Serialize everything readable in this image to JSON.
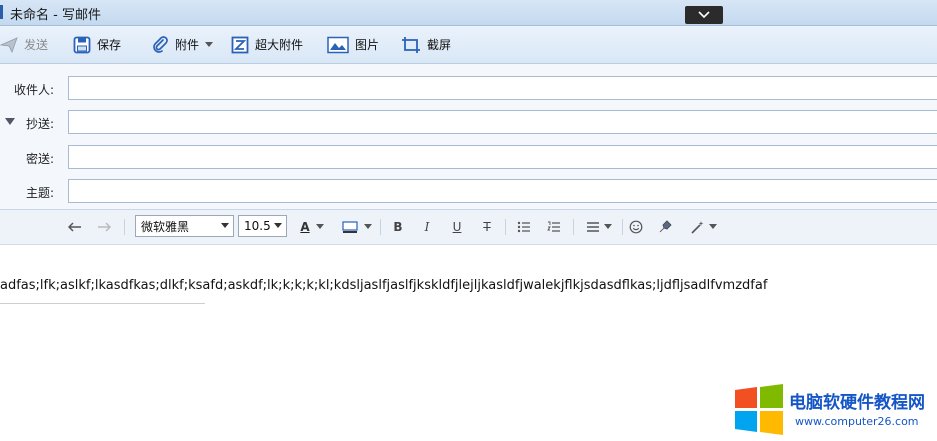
{
  "window": {
    "title": "未命名 - 写邮件"
  },
  "toolbar": {
    "send": "发送",
    "save": "保存",
    "attach": "附件",
    "big_attach": "超大附件",
    "image": "图片",
    "screenshot": "截屏"
  },
  "fields": {
    "to_label": "收件人:",
    "to_value": "",
    "cc_label": "抄送:",
    "cc_value": "",
    "bcc_label": "密送:",
    "bcc_value": "",
    "subject_label": "主题:",
    "subject_value": ""
  },
  "format": {
    "font": "微软雅黑",
    "size": "10.5",
    "font_color_letter": "A",
    "bold": "B",
    "italic": "I",
    "underline": "U",
    "strike": "T"
  },
  "body": {
    "text": "adfas;lfk;aslkf;lkasdfkas;dlkf;ksafd;askdf;lk;k;k;k;kl;kdsljaslfjaslfjkskldfjlejljkasldfjwalekjflkjsdasdflkas;ljdfljsadlfvmzdfaf"
  },
  "watermark": {
    "title": "电脑软硬件教程网",
    "url": "www.computer26.com"
  },
  "colors": {
    "accent": "#1556c6",
    "titlebar": "#c4d9ef",
    "toolbar": "#d9e7f6"
  }
}
